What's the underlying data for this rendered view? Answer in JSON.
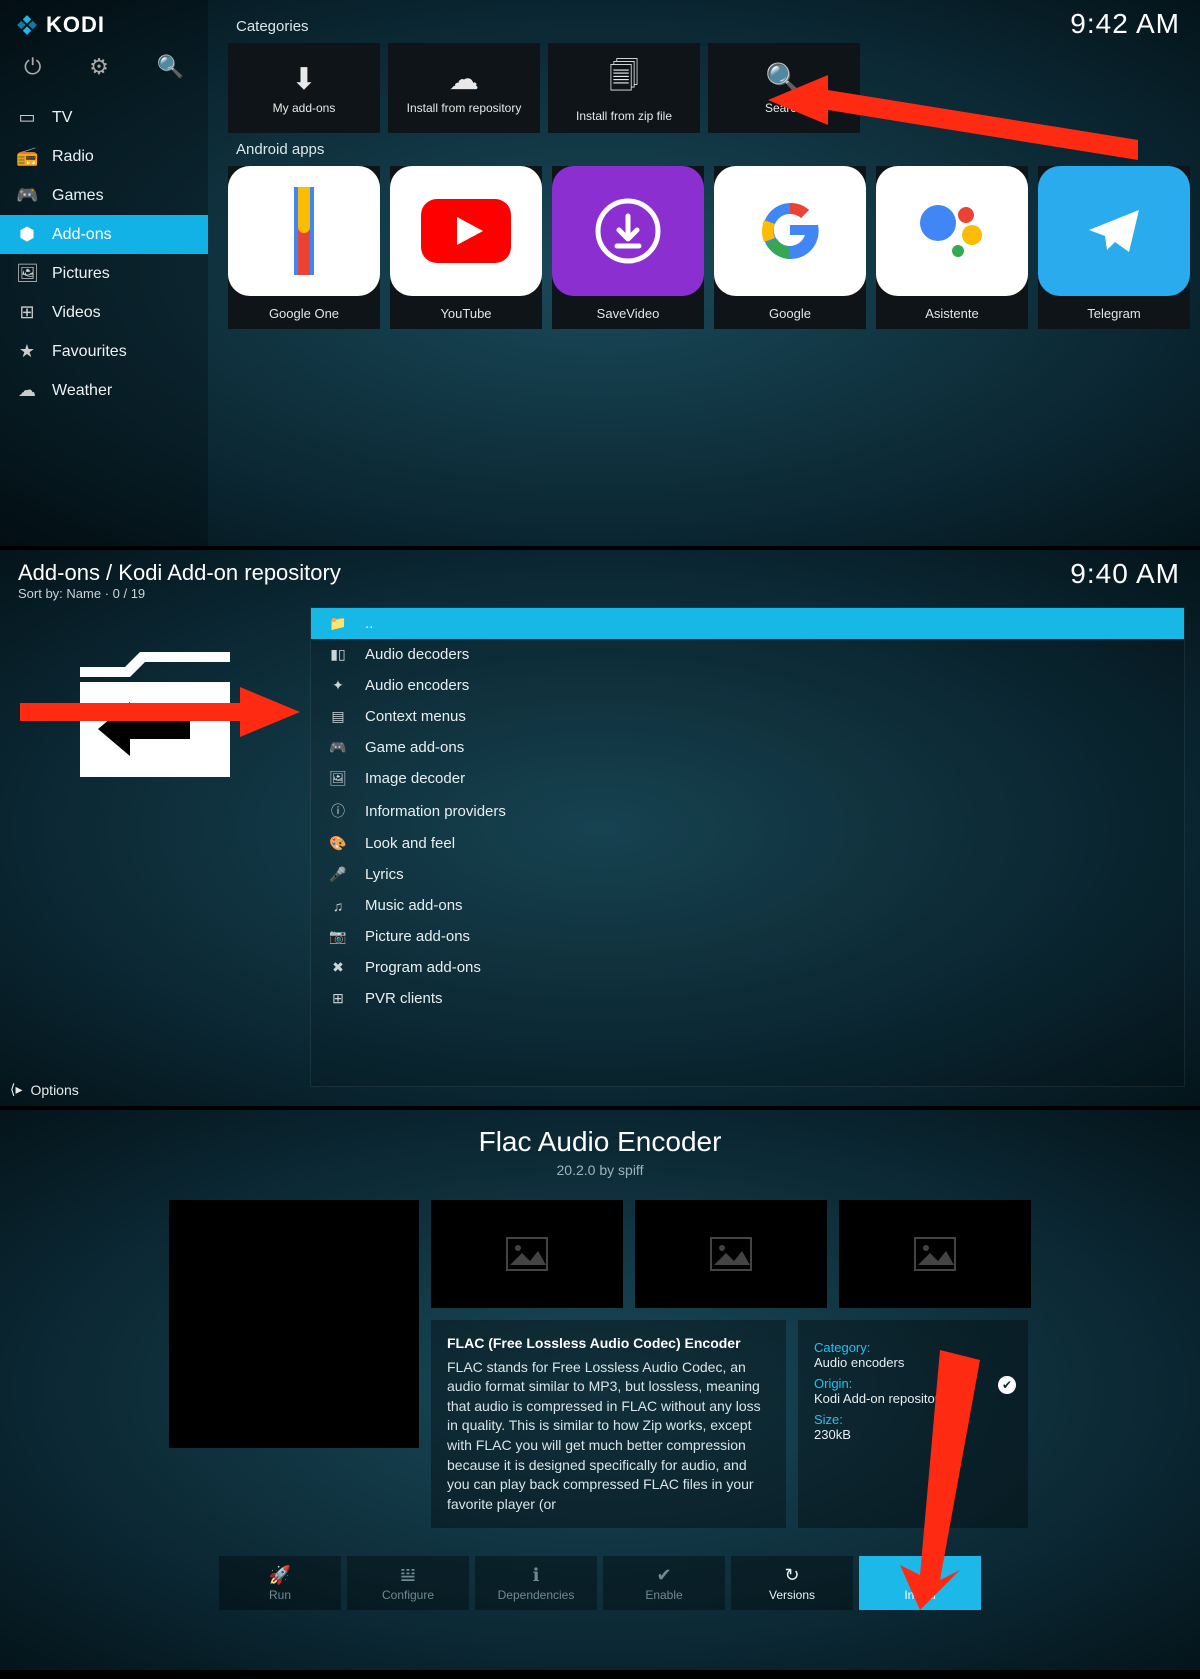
{
  "screen1": {
    "app_name": "KODI",
    "clock": "9:42 AM",
    "nav": [
      {
        "label": "TV",
        "icon": "▭"
      },
      {
        "label": "Radio",
        "icon": "📻"
      },
      {
        "label": "Games",
        "icon": "🎮"
      },
      {
        "label": "Add-ons",
        "icon": "⬢",
        "active": true
      },
      {
        "label": "Pictures",
        "icon": "🖼"
      },
      {
        "label": "Videos",
        "icon": "⊞"
      },
      {
        "label": "Favourites",
        "icon": "★"
      },
      {
        "label": "Weather",
        "icon": "☁"
      }
    ],
    "section_categories": "Categories",
    "tiles": [
      {
        "label": "My add-ons",
        "name": "my-addons-tile",
        "icon": "⬇"
      },
      {
        "label": "Install from repository",
        "name": "install-from-repo-tile",
        "icon": "☁"
      },
      {
        "label": "Install from zip file",
        "name": "install-from-zip-tile",
        "icon": "🗐"
      },
      {
        "label": "Search",
        "name": "search-tile",
        "icon": "🔍"
      }
    ],
    "section_apps": "Android apps",
    "apps": [
      {
        "label": "Google One",
        "name": "app-google-one"
      },
      {
        "label": "YouTube",
        "name": "app-youtube"
      },
      {
        "label": "SaveVideo",
        "name": "app-savevideo"
      },
      {
        "label": "Google",
        "name": "app-google"
      },
      {
        "label": "Asistente",
        "name": "app-asistente"
      },
      {
        "label": "Telegram",
        "name": "app-telegram"
      }
    ]
  },
  "screen2": {
    "breadcrumb": "Add-ons / Kodi Add-on repository",
    "sort_line": "Sort by: Name  ·  0 / 19",
    "clock": "9:40 AM",
    "options_label": "Options",
    "items": [
      {
        "label": "..",
        "icon": "📁",
        "hl": true,
        "name": "row-up"
      },
      {
        "label": "Audio decoders",
        "icon": "▮▯",
        "name": "row-audio-decoders"
      },
      {
        "label": "Audio encoders",
        "icon": "✦",
        "name": "row-audio-encoders"
      },
      {
        "label": "Context menus",
        "icon": "▤",
        "name": "row-context-menus"
      },
      {
        "label": "Game add-ons",
        "icon": "🎮",
        "name": "row-game-addons"
      },
      {
        "label": "Image decoder",
        "icon": "🖼",
        "name": "row-image-decoder"
      },
      {
        "label": "Information providers",
        "icon": "ⓘ",
        "name": "row-info-providers"
      },
      {
        "label": "Look and feel",
        "icon": "🎨",
        "name": "row-look-and-feel"
      },
      {
        "label": "Lyrics",
        "icon": "🎤",
        "name": "row-lyrics"
      },
      {
        "label": "Music add-ons",
        "icon": "♫",
        "name": "row-music-addons"
      },
      {
        "label": "Picture add-ons",
        "icon": "📷",
        "name": "row-picture-addons"
      },
      {
        "label": "Program add-ons",
        "icon": "✖",
        "name": "row-program-addons"
      },
      {
        "label": "PVR clients",
        "icon": "⊞",
        "name": "row-pvr-clients"
      }
    ]
  },
  "screen3": {
    "title": "Flac Audio Encoder",
    "version": "20.2.0",
    "by": "by",
    "author": "spiff",
    "desc_title": "FLAC (Free Lossless Audio Codec) Encoder",
    "desc_body": "FLAC stands for Free Lossless Audio Codec, an audio format similar to MP3, but lossless, meaning that audio is compressed in FLAC without any loss in quality. This is similar to how Zip works, except with FLAC you will get much better compression because it is designed specifically for audio, and you can play back compressed FLAC files in your favorite player (or",
    "meta": {
      "category_label": "Category:",
      "category_value": "Audio encoders",
      "origin_label": "Origin:",
      "origin_value": "Kodi Add-on repository",
      "size_label": "Size:",
      "size_value": "230kB"
    },
    "buttons": {
      "run": "Run",
      "configure": "Configure",
      "dependencies": "Dependencies",
      "enable": "Enable",
      "versions": "Versions",
      "install": "Install"
    }
  }
}
